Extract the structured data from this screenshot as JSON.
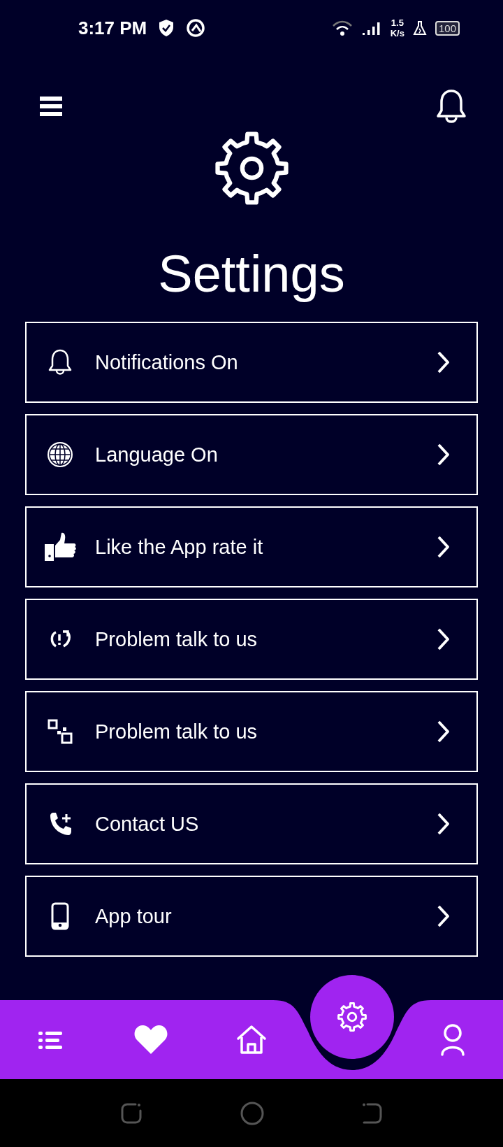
{
  "status_bar": {
    "time": "3:17 PM",
    "speed": "1.5",
    "speed_unit": "K/s",
    "battery": "100"
  },
  "header": {
    "title": "Settings"
  },
  "items": [
    {
      "label": "Notifications On"
    },
    {
      "label": "Language On"
    },
    {
      "label": "Like the App rate it"
    },
    {
      "label": "Problem talk to us"
    },
    {
      "label": "Problem talk to us"
    },
    {
      "label": "Contact US"
    },
    {
      "label": "App tour"
    }
  ],
  "nav": [
    {
      "selected": false
    },
    {
      "selected": false
    },
    {
      "selected": false
    },
    {
      "selected": true
    },
    {
      "selected": false
    }
  ]
}
